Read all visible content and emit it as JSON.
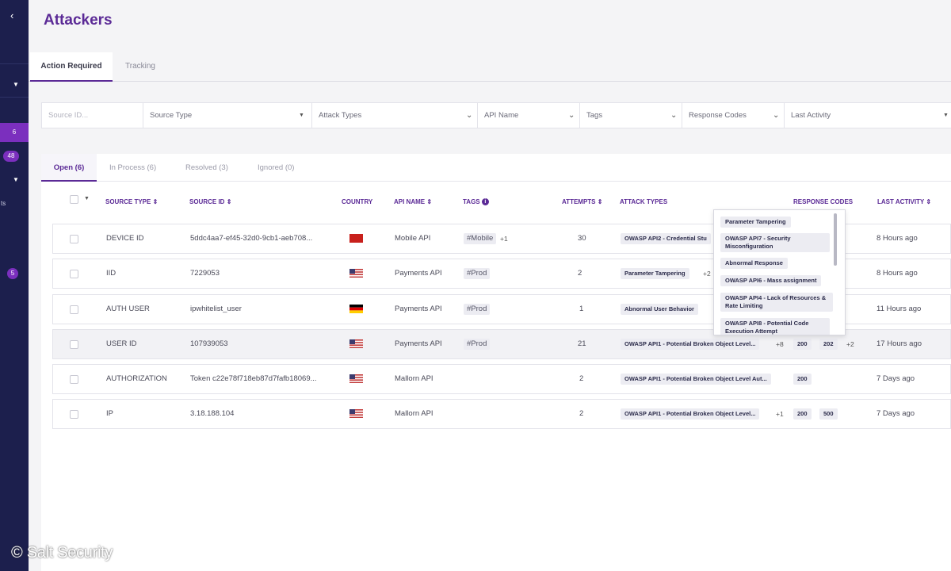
{
  "app": {
    "title": "Attackers",
    "watermark": "© Salt Security"
  },
  "colors": {
    "brand_purple": "#5b2a96",
    "sidebar": "#1c1f4d",
    "badge": "#7b2fbe"
  },
  "sidebar": {
    "collapse_icon": "chevron-left-icon",
    "badges": [
      "6",
      "48",
      "5"
    ],
    "partial_text": "ts"
  },
  "main_tabs": [
    {
      "label": "Action Required",
      "active": true
    },
    {
      "label": "Tracking",
      "active": false
    }
  ],
  "filters": [
    {
      "label": "",
      "placeholder": "Source ID..."
    },
    {
      "label": "Source Type"
    },
    {
      "label": "Attack Types"
    },
    {
      "label": "API Name"
    },
    {
      "label": "Tags"
    },
    {
      "label": "Response Codes"
    },
    {
      "label": "Last Activity"
    }
  ],
  "status_tabs": [
    {
      "label": "Open (6)",
      "active": true
    },
    {
      "label": "In Process (6)"
    },
    {
      "label": "Resolved (3)"
    },
    {
      "label": "Ignored (0)"
    }
  ],
  "columns": {
    "source_type": "SOURCE TYPE",
    "source_id": "SOURCE ID",
    "country": "COUNTRY",
    "api_name": "API NAME",
    "tags": "TAGS",
    "attempts": "ATTEMPTS",
    "attack_types": "ATTACK TYPES",
    "response_codes": "RESPONSE CODES",
    "last_activity": "LAST ACTIVITY"
  },
  "rows": [
    {
      "source_type": "DEVICE ID",
      "source_id": "5ddc4aa7-ef45-32d0-9cb1-aeb708...",
      "country_flag": "china-flag",
      "api_name": "Mobile API",
      "tag": "#Mobile",
      "tag_more": "+1",
      "attempts": "30",
      "attack": "OWASP API2 - Credential Stu",
      "attack_more": "",
      "codes": [],
      "codes_more": "",
      "last_activity": "8 Hours ago"
    },
    {
      "source_type": "IID",
      "source_id": "7229053",
      "country_flag": "us-flag",
      "api_name": "Payments API",
      "tag": "#Prod",
      "tag_more": "",
      "attempts": "2",
      "attack": "Parameter Tampering",
      "attack_more": "+2",
      "codes": [],
      "codes_more": "",
      "last_activity": "8 Hours ago"
    },
    {
      "source_type": "AUTH USER",
      "source_id": "ipwhitelist_user",
      "country_flag": "germany-flag",
      "api_name": "Payments API",
      "tag": "#Prod",
      "tag_more": "",
      "attempts": "1",
      "attack": "Abnormal User Behavior",
      "attack_more": "",
      "codes": [],
      "codes_more": "",
      "last_activity": "11 Hours ago"
    },
    {
      "source_type": "USER ID",
      "source_id": "107939053",
      "country_flag": "us-flag",
      "api_name": "Payments API",
      "tag": "#Prod",
      "tag_more": "",
      "attempts": "21",
      "attack": "OWASP API1 - Potential Broken Object Level...",
      "attack_more": "+8",
      "codes": [
        "200",
        "202"
      ],
      "codes_more": "+2",
      "last_activity": "17 Hours ago"
    },
    {
      "source_type": "AUTHORIZATION",
      "source_id": "Token c22e78f718eb87d7fafb18069...",
      "country_flag": "us-flag",
      "api_name": "Mallorn API",
      "tag": "",
      "tag_more": "",
      "attempts": "2",
      "attack": "OWASP API1 - Potential Broken Object Level Aut...",
      "attack_more": "",
      "codes": [
        "200"
      ],
      "codes_more": "",
      "last_activity": "7 Days ago"
    },
    {
      "source_type": "IP",
      "source_id": "3.18.188.104",
      "country_flag": "us-flag",
      "api_name": "Mallorn API",
      "tag": "",
      "tag_more": "",
      "attempts": "2",
      "attack": "OWASP API1 - Potential Broken Object Level...",
      "attack_more": "+1",
      "codes": [
        "200",
        "500"
      ],
      "codes_more": "",
      "last_activity": "7 Days ago"
    }
  ],
  "popup": {
    "items": [
      "Parameter Tampering",
      "OWASP API7 - Security Misconfiguration",
      "Abnormal Response",
      "OWASP API6 - Mass assignment",
      "OWASP API4 - Lack of Resources & Rate Limiting",
      "OWASP API8 - Potential Code Execution Attempt"
    ]
  }
}
